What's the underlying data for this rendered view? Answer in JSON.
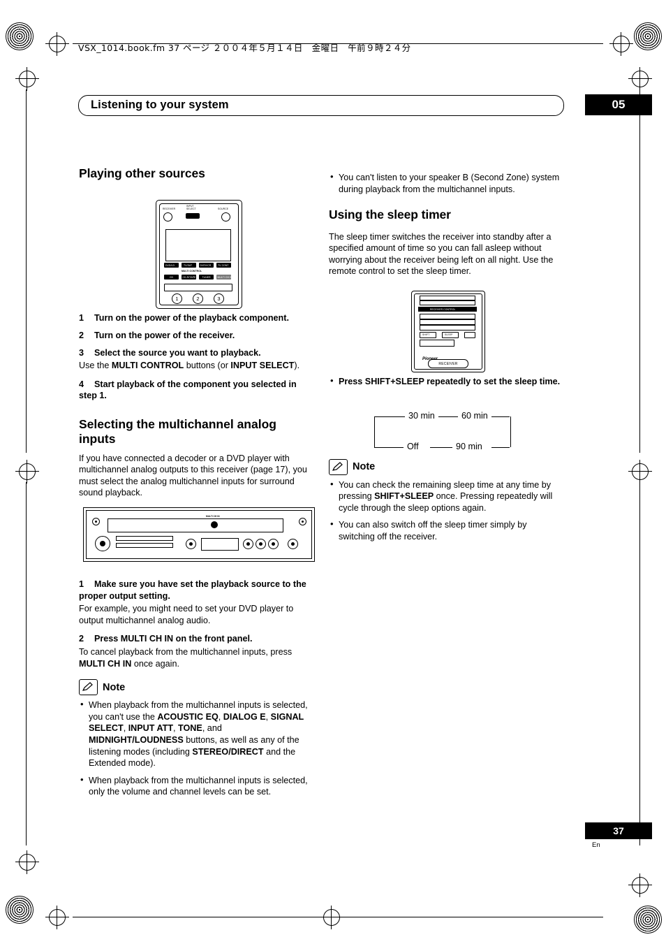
{
  "header": {
    "file_line": "VSX_1014.book.fm 37 ページ ２００４年５月１４日　金曜日　午前９時２４分",
    "chapter_title": "Listening to your system",
    "chapter_number": "05"
  },
  "left_column": {
    "heading1": "Playing other sources",
    "steps1": [
      {
        "num": "1",
        "text": "Turn on the power of the playback component."
      },
      {
        "num": "2",
        "text": "Turn on the power of the receiver."
      },
      {
        "num": "3",
        "text": "Select the source you want to playback."
      },
      {
        "num": "4",
        "text": "Start playback of the component you selected in step 1."
      }
    ],
    "step3_sub_pre": "Use the ",
    "step3_sub_b1": "MULTI CONTROL",
    "step3_sub_mid": " buttons (or ",
    "step3_sub_b2": "INPUT SELECT",
    "step3_sub_post": ").",
    "heading2": "Selecting the multichannel analog inputs",
    "para2": "If you have connected a decoder or a DVD player with multichannel analog outputs to this receiver (page 17), you must select the analog multichannel inputs for surround sound playback.",
    "steps2": [
      {
        "num": "1",
        "text": "Make sure you have set the playback source to the proper output setting."
      },
      {
        "num": "2",
        "text": "Press MULTI CH IN on the front panel."
      }
    ],
    "step2_1_sub": "For example, you might need to set your DVD player to output multichannel analog audio.",
    "step2_2_sub_pre": "To cancel playback from the multichannel inputs, press ",
    "step2_2_sub_b": "MULTI CH IN",
    "step2_2_sub_post": " once again.",
    "note_label": "Note",
    "notes": [
      {
        "pre": "When playback from the multichannel inputs is selected, you can't use the ",
        "b1": "ACOUSTIC EQ",
        "s1": ", ",
        "b2": "DIALOG E",
        "s2": ", ",
        "b3": "SIGNAL SELECT",
        "s3": ", ",
        "b4": "INPUT ATT",
        "s4": ", ",
        "b5": "TONE",
        "s5": ", and ",
        "b6": "MIDNIGHT/LOUDNESS",
        "s6": " buttons, as well as any of the listening modes (including ",
        "b7": "STEREO/DIRECT",
        "s7": " and the Extended mode)."
      },
      {
        "text": "When playback from the multichannel inputs is selected, only the volume and channel levels can be set."
      }
    ]
  },
  "right_column": {
    "bullet_top": "You can't listen to your speaker B (Second Zone) system during playback from the multichannel inputs.",
    "heading1": "Using the sleep timer",
    "para1": "The sleep timer switches the receiver into standby after a specified amount of time so you can fall asleep without worrying about the receiver being left on all night. Use the remote control to set the sleep timer.",
    "bullet_press": "Press SHIFT+SLEEP repeatedly to set the sleep time.",
    "sleep_diagram": {
      "options": [
        "30 min",
        "60 min",
        "90 min",
        "Off"
      ]
    },
    "note_label": "Note",
    "notes": [
      {
        "pre": "You can check the remaining sleep time at any time by pressing ",
        "b1": "SHIFT+SLEEP",
        "post": " once. Pressing repeatedly will cycle through the sleep options again."
      },
      {
        "text": "You can also switch off the sleep timer simply by switching off the receiver."
      }
    ]
  },
  "remote1": {
    "labels": {
      "receiver": "RECEIVER",
      "input_sel": "INPUT SELECT",
      "source": "SOURCE",
      "multi_control": "MULTI CONTROL",
      "btn_dvd": "DVD/LD",
      "btn_tvsat": "TV/SAT",
      "btn_dvrvcr": "DVR/VCR",
      "btn_tvcont": "TV CONT",
      "btn_cd": "CD",
      "btn_cdrtape": "CD-R/TAPE",
      "btn_tuner": "TUNER",
      "btn_multich": "MULTI CH IN",
      "n1": "1",
      "n2": "2",
      "n3": "3"
    }
  },
  "remote2": {
    "labels": {
      "receiver_control": "RECEIVER CONTROL",
      "pioneer": "Pioneer",
      "receiver_oval": "RECEIVER",
      "shift": "SHIFT",
      "sleep": "SLEEP"
    }
  },
  "rear_panel": {
    "labels": {
      "multi_ch_in": "MULTI CH IN"
    }
  },
  "footer": {
    "page_number": "37",
    "lang": "En"
  }
}
